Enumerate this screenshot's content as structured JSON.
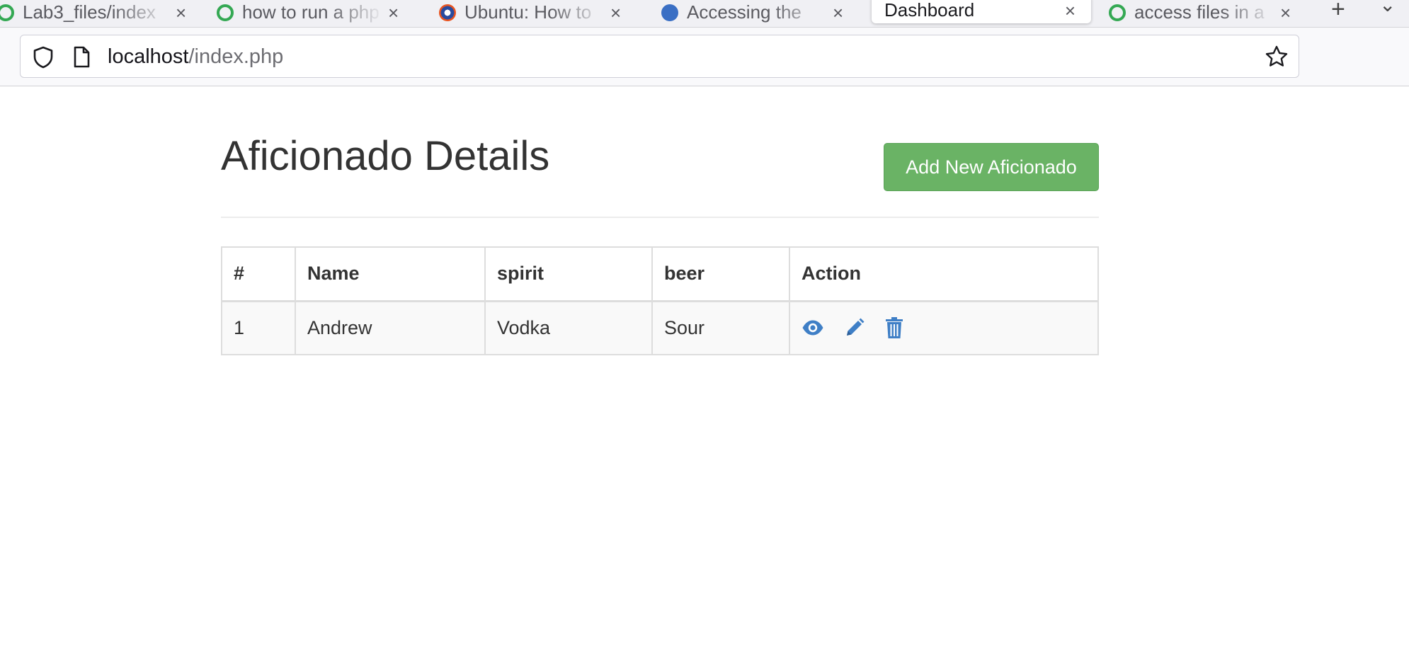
{
  "browser": {
    "tabs": [
      {
        "label": "Lab3_files/index",
        "close": "×"
      },
      {
        "label": "how to run a php",
        "close": "×"
      },
      {
        "label": "Ubuntu: How to",
        "close": "×"
      },
      {
        "label": "Accessing the",
        "close": "×"
      },
      {
        "label": "Dashboard",
        "close": "×",
        "active": true
      },
      {
        "label": "access files in a",
        "close": "×"
      }
    ],
    "new_tab": "+",
    "tab_list": "⌄",
    "url": {
      "host": "localhost",
      "path": "/index.php"
    }
  },
  "page": {
    "title": "Aficionado Details",
    "add_button": "Add New Aficionado",
    "accent_color": "#6ab365",
    "icon_color": "#3f7fc6"
  },
  "table": {
    "headers": [
      "#",
      "Name",
      "spirit",
      "beer",
      "Action"
    ],
    "rows": [
      {
        "num": "1",
        "name": "Andrew",
        "spirit": "Vodka",
        "beer": "Sour",
        "actions": [
          "eye-icon",
          "pencil-icon",
          "trash-icon"
        ]
      }
    ]
  }
}
